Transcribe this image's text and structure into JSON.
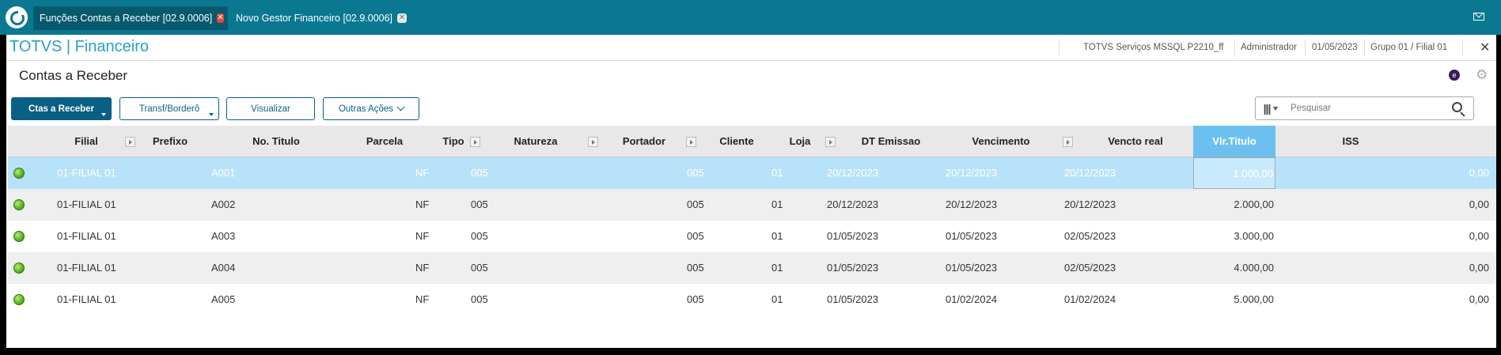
{
  "tabs": [
    {
      "label": "Funções Contas a Receber [02.9.0006]",
      "close_glyph": "✕"
    },
    {
      "label": "Novo Gestor Financeiro [02.9.0006]",
      "close_glyph": "✕"
    }
  ],
  "header": {
    "brand": "TOTVS | Financeiro",
    "environment": "TOTVS Serviços MSSQL P2210_ff",
    "user": "Administrador",
    "date": "01/05/2023",
    "branch": "Grupo 01 / Filial 01",
    "close_glyph": "✕"
  },
  "page": {
    "title": "Contas a Receber",
    "e_icon_glyph": "e",
    "settings_glyph": "⚙"
  },
  "toolbar": {
    "ctas_label": "Ctas a Receber",
    "transf_label": "Transf/Borderô",
    "visualizar_label": "Visualizar",
    "outras_label": "Outras Ações"
  },
  "search": {
    "placeholder": "Pesquisar",
    "columns_glyph": "|||"
  },
  "table": {
    "columns": [
      "Filial",
      "Prefixo",
      "No. Titulo",
      "Parcela",
      "Tipo",
      "Natureza",
      "Portador",
      "Cliente",
      "Loja",
      "DT Emissao",
      "Vencimento",
      "Vencto real",
      "Vlr.Titulo",
      "ISS"
    ],
    "sorted_column": "Vlr.Titulo",
    "rows": [
      {
        "filial": "01-FILIAL 01",
        "prefixo": "",
        "no_titulo": "A001",
        "parcela": "",
        "tipo": "NF",
        "natureza": "005",
        "portador": "",
        "cliente": "005",
        "loja": "01",
        "dt_emissao": "20/12/2023",
        "vencimento": "20/12/2023",
        "vencto_real": "20/12/2023",
        "vlr_titulo": "1.000,00",
        "iss": "0,00",
        "status_color": "#4aa513"
      },
      {
        "filial": "01-FILIAL 01",
        "prefixo": "",
        "no_titulo": "A002",
        "parcela": "",
        "tipo": "NF",
        "natureza": "005",
        "portador": "",
        "cliente": "005",
        "loja": "01",
        "dt_emissao": "20/12/2023",
        "vencimento": "20/12/2023",
        "vencto_real": "20/12/2023",
        "vlr_titulo": "2.000,00",
        "iss": "0,00",
        "status_color": "#4aa513"
      },
      {
        "filial": "01-FILIAL 01",
        "prefixo": "",
        "no_titulo": "A003",
        "parcela": "",
        "tipo": "NF",
        "natureza": "005",
        "portador": "",
        "cliente": "005",
        "loja": "01",
        "dt_emissao": "01/05/2023",
        "vencimento": "01/05/2023",
        "vencto_real": "02/05/2023",
        "vlr_titulo": "3.000,00",
        "iss": "0,00",
        "status_color": "#4aa513"
      },
      {
        "filial": "01-FILIAL 01",
        "prefixo": "",
        "no_titulo": "A004",
        "parcela": "",
        "tipo": "NF",
        "natureza": "005",
        "portador": "",
        "cliente": "005",
        "loja": "01",
        "dt_emissao": "01/05/2023",
        "vencimento": "01/05/2023",
        "vencto_real": "02/05/2023",
        "vlr_titulo": "4.000,00",
        "iss": "0,00",
        "status_color": "#4aa513"
      },
      {
        "filial": "01-FILIAL 01",
        "prefixo": "",
        "no_titulo": "A005",
        "parcela": "",
        "tipo": "NF",
        "natureza": "005",
        "portador": "",
        "cliente": "005",
        "loja": "01",
        "dt_emissao": "01/05/2023",
        "vencimento": "01/02/2024",
        "vencto_real": "01/02/2024",
        "vlr_titulo": "5.000,00",
        "iss": "0,00",
        "status_color": "#4aa513"
      }
    ]
  },
  "colors": {
    "topbar": "#0b7892",
    "brand": "#2a9fc4",
    "primary_button": "#0a5f84",
    "selected_row": "#b8e2fa",
    "sorted_header": "#6cc0ef"
  }
}
